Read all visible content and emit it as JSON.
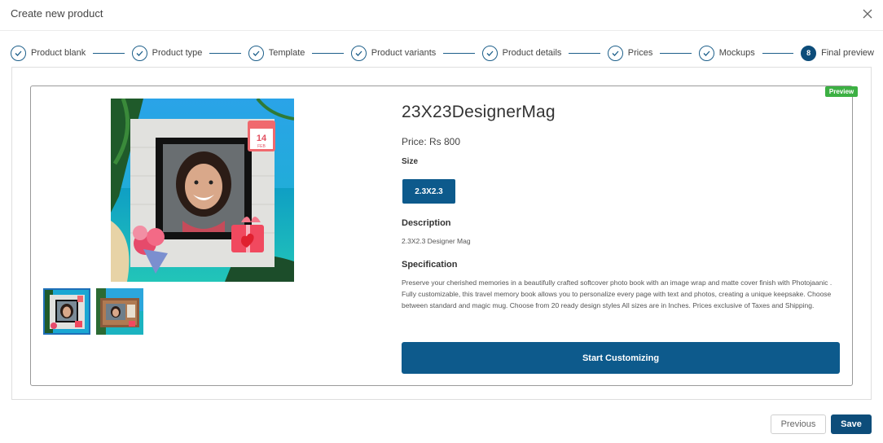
{
  "modal": {
    "title": "Create new product",
    "close_icon": "close-icon"
  },
  "stepper": {
    "steps": [
      {
        "label": "Product blank",
        "state": "completed",
        "icon": "check-icon"
      },
      {
        "label": "Product type",
        "state": "completed",
        "icon": "check-icon"
      },
      {
        "label": "Template",
        "state": "completed",
        "icon": "check-icon"
      },
      {
        "label": "Product variants",
        "state": "completed",
        "icon": "check-icon"
      },
      {
        "label": "Product details",
        "state": "completed",
        "icon": "check-icon"
      },
      {
        "label": "Prices",
        "state": "completed",
        "icon": "check-icon"
      },
      {
        "label": "Mockups",
        "state": "completed",
        "icon": "check-icon"
      },
      {
        "label": "Final preview",
        "state": "active",
        "number": "8"
      }
    ]
  },
  "preview": {
    "badge": "Preview",
    "product_title": "23X23DesignerMag",
    "price": "Price: Rs 800",
    "size_label": "Size",
    "size_option": "2.3X2.3",
    "description_heading": "Description",
    "description_text": "2.3X2.3 Designer Mag",
    "specification_heading": "Specification",
    "specification_text": "Preserve your cherished memories in a beautifully crafted softcover photo book with an image wrap and matte cover finish with Photojaanic . Fully customizable, this travel memory book allows you to personalize every page with text and photos, creating a unique keepsake. Choose between standard and magic mug. Choose from 20 ready design styles All sizes are in Inches. Prices exclusive of Taxes and Shipping.",
    "cta": "Start Customizing"
  },
  "footer": {
    "previous": "Previous",
    "save": "Save"
  },
  "colors": {
    "primary": "#0d5a8c",
    "stepper": "#1d5f8a",
    "badge": "#3cb043"
  }
}
